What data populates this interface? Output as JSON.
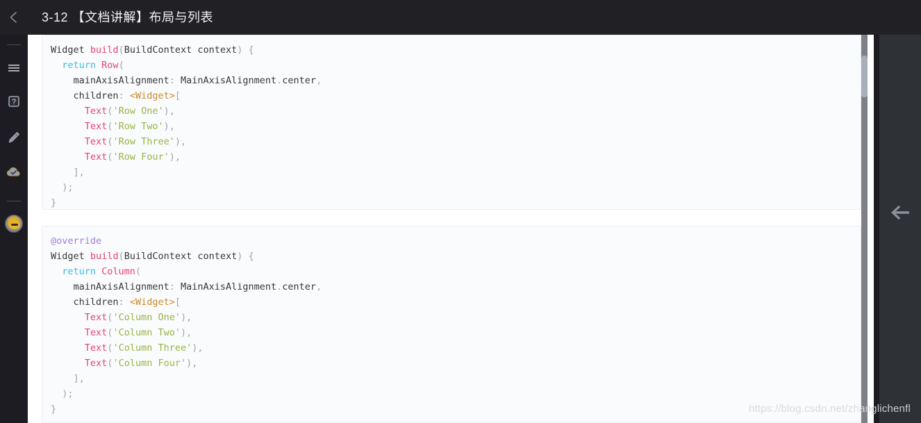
{
  "header": {
    "back_icon": "arrow-left-icon",
    "title": "3-12 【文档讲解】布局与列表"
  },
  "sidebar": {
    "items": [
      {
        "icon": "menu-icon",
        "label": "菜单"
      },
      {
        "icon": "help-icon",
        "label": "帮助"
      },
      {
        "icon": "pencil-icon",
        "label": "笔记"
      },
      {
        "icon": "cloud-check-icon",
        "label": "已保存"
      }
    ],
    "avatar": {
      "icon": "user-avatar",
      "label": "用户头像"
    }
  },
  "right_panel": {
    "collapse_icon": "arrow-left-icon"
  },
  "scrollbar": {
    "thumb_position_pct": 5
  },
  "watermark": {
    "text_light": "https://blog.csdn.net/zha",
    "text_dark": "nglichenfl",
    "full": "https://blog.csdn.net/zhanglichenfl"
  },
  "code_blocks": [
    {
      "id": "row-example",
      "language": "dart",
      "lines": [
        [
          {
            "t": "Widget ",
            "c": "t-plain"
          },
          {
            "t": "build",
            "c": "t-fn"
          },
          {
            "t": "(",
            "c": "t-punct"
          },
          {
            "t": "BuildContext context",
            "c": "t-plain"
          },
          {
            "t": ")",
            "c": "t-punct"
          },
          {
            "t": " ",
            "c": "t-plain"
          },
          {
            "t": "{",
            "c": "t-punct"
          }
        ],
        [
          {
            "t": "  ",
            "c": "t-plain"
          },
          {
            "t": "return ",
            "c": "t-kw"
          },
          {
            "t": "Row",
            "c": "t-fn"
          },
          {
            "t": "(",
            "c": "t-punct"
          }
        ],
        [
          {
            "t": "    mainAxisAlignment",
            "c": "t-plain"
          },
          {
            "t": ":",
            "c": "t-punct"
          },
          {
            "t": " MainAxisAlignment",
            "c": "t-plain"
          },
          {
            "t": ".",
            "c": "t-punct"
          },
          {
            "t": "center",
            "c": "t-plain"
          },
          {
            "t": ",",
            "c": "t-punct"
          }
        ],
        [
          {
            "t": "    children",
            "c": "t-plain"
          },
          {
            "t": ":",
            "c": "t-punct"
          },
          {
            "t": " ",
            "c": "t-plain"
          },
          {
            "t": "<Widget>",
            "c": "t-angle"
          },
          {
            "t": "[",
            "c": "t-punct"
          }
        ],
        [
          {
            "t": "      ",
            "c": "t-plain"
          },
          {
            "t": "Text",
            "c": "t-fn"
          },
          {
            "t": "(",
            "c": "t-punct"
          },
          {
            "t": "'Row One'",
            "c": "t-str"
          },
          {
            "t": ")",
            "c": "t-punct"
          },
          {
            "t": ",",
            "c": "t-punct"
          }
        ],
        [
          {
            "t": "      ",
            "c": "t-plain"
          },
          {
            "t": "Text",
            "c": "t-fn"
          },
          {
            "t": "(",
            "c": "t-punct"
          },
          {
            "t": "'Row Two'",
            "c": "t-str"
          },
          {
            "t": ")",
            "c": "t-punct"
          },
          {
            "t": ",",
            "c": "t-punct"
          }
        ],
        [
          {
            "t": "      ",
            "c": "t-plain"
          },
          {
            "t": "Text",
            "c": "t-fn"
          },
          {
            "t": "(",
            "c": "t-punct"
          },
          {
            "t": "'Row Three'",
            "c": "t-str"
          },
          {
            "t": ")",
            "c": "t-punct"
          },
          {
            "t": ",",
            "c": "t-punct"
          }
        ],
        [
          {
            "t": "      ",
            "c": "t-plain"
          },
          {
            "t": "Text",
            "c": "t-fn"
          },
          {
            "t": "(",
            "c": "t-punct"
          },
          {
            "t": "'Row Four'",
            "c": "t-str"
          },
          {
            "t": ")",
            "c": "t-punct"
          },
          {
            "t": ",",
            "c": "t-punct"
          }
        ],
        [
          {
            "t": "    ",
            "c": "t-plain"
          },
          {
            "t": "],",
            "c": "t-punct"
          }
        ],
        [
          {
            "t": "  ",
            "c": "t-plain"
          },
          {
            "t": ");",
            "c": "t-punct"
          }
        ],
        [
          {
            "t": "}",
            "c": "t-punct"
          }
        ]
      ]
    },
    {
      "id": "column-example",
      "language": "dart",
      "lines": [
        [
          {
            "t": "@override",
            "c": "t-ann"
          }
        ],
        [
          {
            "t": "Widget ",
            "c": "t-plain"
          },
          {
            "t": "build",
            "c": "t-fn"
          },
          {
            "t": "(",
            "c": "t-punct"
          },
          {
            "t": "BuildContext context",
            "c": "t-plain"
          },
          {
            "t": ")",
            "c": "t-punct"
          },
          {
            "t": " ",
            "c": "t-plain"
          },
          {
            "t": "{",
            "c": "t-punct"
          }
        ],
        [
          {
            "t": "  ",
            "c": "t-plain"
          },
          {
            "t": "return ",
            "c": "t-kw"
          },
          {
            "t": "Column",
            "c": "t-fn"
          },
          {
            "t": "(",
            "c": "t-punct"
          }
        ],
        [
          {
            "t": "    mainAxisAlignment",
            "c": "t-plain"
          },
          {
            "t": ":",
            "c": "t-punct"
          },
          {
            "t": " MainAxisAlignment",
            "c": "t-plain"
          },
          {
            "t": ".",
            "c": "t-punct"
          },
          {
            "t": "center",
            "c": "t-plain"
          },
          {
            "t": ",",
            "c": "t-punct"
          }
        ],
        [
          {
            "t": "    children",
            "c": "t-plain"
          },
          {
            "t": ":",
            "c": "t-punct"
          },
          {
            "t": " ",
            "c": "t-plain"
          },
          {
            "t": "<Widget>",
            "c": "t-angle"
          },
          {
            "t": "[",
            "c": "t-punct"
          }
        ],
        [
          {
            "t": "      ",
            "c": "t-plain"
          },
          {
            "t": "Text",
            "c": "t-fn"
          },
          {
            "t": "(",
            "c": "t-punct"
          },
          {
            "t": "'Column One'",
            "c": "t-str"
          },
          {
            "t": ")",
            "c": "t-punct"
          },
          {
            "t": ",",
            "c": "t-punct"
          }
        ],
        [
          {
            "t": "      ",
            "c": "t-plain"
          },
          {
            "t": "Text",
            "c": "t-fn"
          },
          {
            "t": "(",
            "c": "t-punct"
          },
          {
            "t": "'Column Two'",
            "c": "t-str"
          },
          {
            "t": ")",
            "c": "t-punct"
          },
          {
            "t": ",",
            "c": "t-punct"
          }
        ],
        [
          {
            "t": "      ",
            "c": "t-plain"
          },
          {
            "t": "Text",
            "c": "t-fn"
          },
          {
            "t": "(",
            "c": "t-punct"
          },
          {
            "t": "'Column Three'",
            "c": "t-str"
          },
          {
            "t": ")",
            "c": "t-punct"
          },
          {
            "t": ",",
            "c": "t-punct"
          }
        ],
        [
          {
            "t": "      ",
            "c": "t-plain"
          },
          {
            "t": "Text",
            "c": "t-fn"
          },
          {
            "t": "(",
            "c": "t-punct"
          },
          {
            "t": "'Column Four'",
            "c": "t-str"
          },
          {
            "t": ")",
            "c": "t-punct"
          },
          {
            "t": ",",
            "c": "t-punct"
          }
        ],
        [
          {
            "t": "    ",
            "c": "t-plain"
          },
          {
            "t": "],",
            "c": "t-punct"
          }
        ],
        [
          {
            "t": "  ",
            "c": "t-plain"
          },
          {
            "t": ");",
            "c": "t-punct"
          }
        ],
        [
          {
            "t": "}",
            "c": "t-punct"
          }
        ]
      ]
    }
  ],
  "colors": {
    "header_bg": "#212125",
    "sidebar_bg": "#1c1c22",
    "code_bg": "#fafbfd",
    "right_panel_bg": "#2e3136",
    "keyword": "#3fb9e0",
    "function": "#e8436f",
    "string": "#97b442",
    "annotation": "#a37ee0",
    "angle": "#c98a28",
    "scrollbar_track": "#7d8186",
    "scrollbar_thumb": "#a7b0b8"
  }
}
